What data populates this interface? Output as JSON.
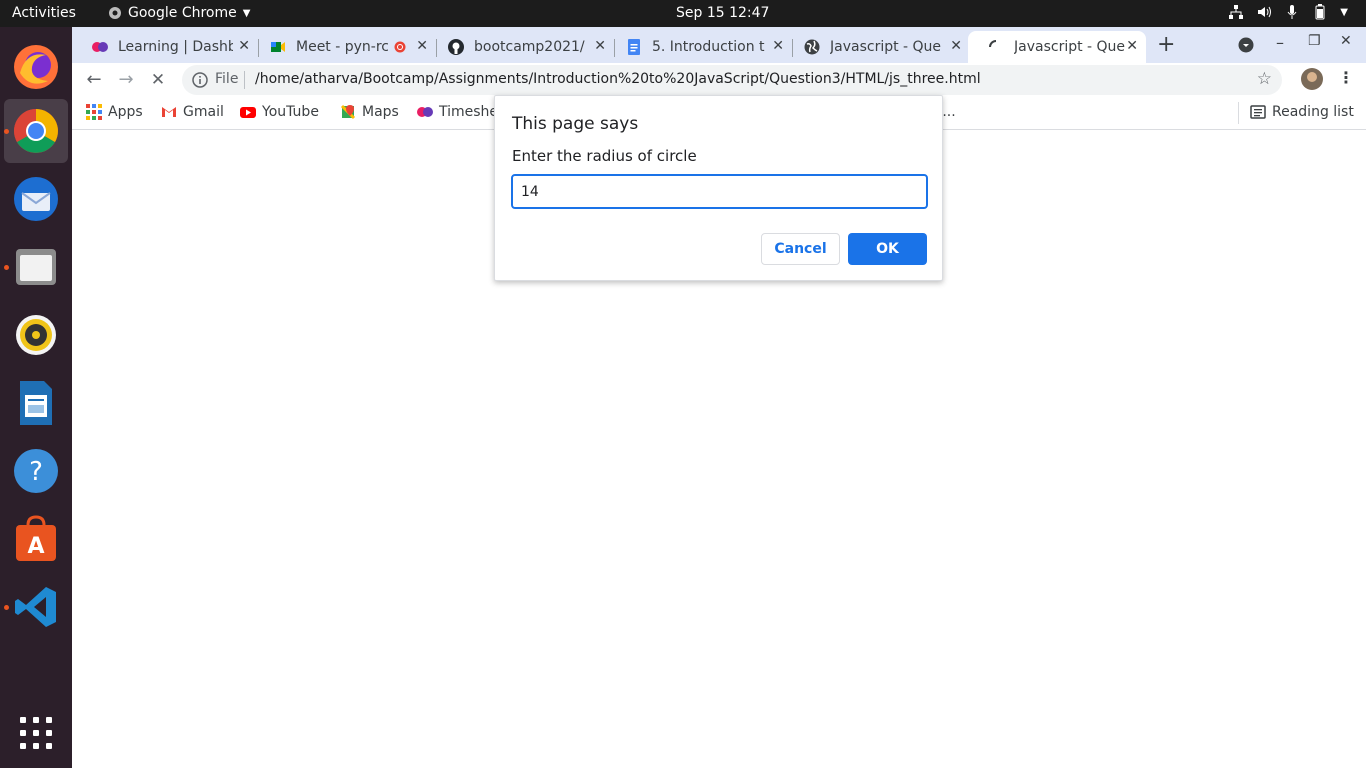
{
  "topbar": {
    "activities": "Activities",
    "app_name": "Google Chrome",
    "clock": "Sep 15  12:47"
  },
  "dock": {
    "apps": [
      "firefox-icon",
      "chrome-icon",
      "thunderbird-icon",
      "files-icon",
      "rhythmbox-icon",
      "writer-icon",
      "help-icon",
      "software-icon",
      "vscode-icon",
      "show-apps-icon"
    ],
    "active": "chrome-icon"
  },
  "tabs": [
    {
      "title": "Learning | Dashb",
      "icon": "learning-favicon"
    },
    {
      "title": "Meet - pyn-rcc",
      "icon": "meet-favicon",
      "recording": true
    },
    {
      "title": "bootcamp2021/",
      "icon": "github-favicon"
    },
    {
      "title": "5. Introduction t",
      "icon": "docs-favicon"
    },
    {
      "title": "Javascript - Que",
      "icon": "globe-favicon"
    },
    {
      "title": "Javascript - Que",
      "icon": "loading-favicon",
      "active": true
    }
  ],
  "toolbar": {
    "scheme": "File",
    "url": "/home/atharva/Bootcamp/Assignments/Introduction%20to%20JavaScript/Question3/HTML/js_three.html"
  },
  "bookmarks": [
    {
      "label": "Apps",
      "icon": "apps-grid-icon"
    },
    {
      "label": "Gmail",
      "icon": "gmail-icon"
    },
    {
      "label": "YouTube",
      "icon": "youtube-icon"
    },
    {
      "label": "Maps",
      "icon": "maps-icon"
    },
    {
      "label": "Timeshe",
      "icon": "timesheet-icon"
    },
    {
      "label": "o...",
      "icon": ""
    }
  ],
  "reading_list": "Reading list",
  "dialog": {
    "title": "This page says",
    "message": "Enter the radius of circle",
    "input_value": "14",
    "cancel_label": "Cancel",
    "ok_label": "OK"
  },
  "colors": {
    "accent": "#1a73e8",
    "topbar": "#1c1c1c",
    "dock": "#2c1f2a",
    "tabstrip": "#dfe6f7"
  }
}
